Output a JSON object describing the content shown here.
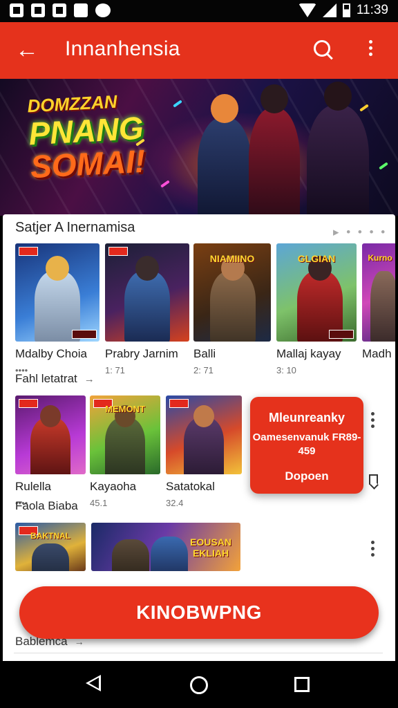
{
  "status_bar": {
    "time": "11:39"
  },
  "app_bar": {
    "title": "Innanhensia",
    "back_icon": "arrow-left-icon",
    "search_icon": "search-icon",
    "menu_icon": "more-vertical-icon"
  },
  "banner": {
    "line1": "DOMZZAN",
    "line2": "PNANG",
    "line3": "SOMAI!"
  },
  "section1": {
    "title": "Satjer A Inernamisa",
    "more": "▸ • • • • •",
    "cards": [
      {
        "title": "Mdalby Choia",
        "meta": "••••"
      },
      {
        "title": "Prabry Jarnim",
        "meta": "1: 71",
        "thumb_text": ""
      },
      {
        "title": "Balli",
        "meta": "2: 71",
        "thumb_text": "NIAMIINO"
      },
      {
        "title": "Mallaj kayay",
        "meta": "3: 10",
        "thumb_text": "GLGIAN"
      },
      {
        "title": "Madh",
        "meta": "",
        "thumb_text": "Kurno"
      }
    ]
  },
  "section2": {
    "title": "Fahl letatrat",
    "cards": [
      {
        "title": "Rulella",
        "meta": "••••"
      },
      {
        "title": "Kayaoha",
        "meta": "45.1",
        "thumb_text": "MEMONT"
      },
      {
        "title": "Satatokal",
        "meta": "32.4",
        "thumb_text": ""
      }
    ]
  },
  "popup": {
    "line1": "Mleunreanky",
    "line2": "Oamesenvanuk FR89-459",
    "line3": "Dopoen"
  },
  "section3": {
    "title": "Faola Biaba",
    "cards": [
      {
        "thumb_text": "BAKTNAL"
      },
      {
        "thumb_text": "EOUSAN EKLIAH"
      }
    ]
  },
  "main_button": {
    "label": "KINOBWPNG"
  },
  "bottom_section": {
    "title": "Bablemca"
  },
  "colors": {
    "accent": "#e5321c",
    "status_bar": "#050505",
    "nav_bar": "#000000"
  }
}
